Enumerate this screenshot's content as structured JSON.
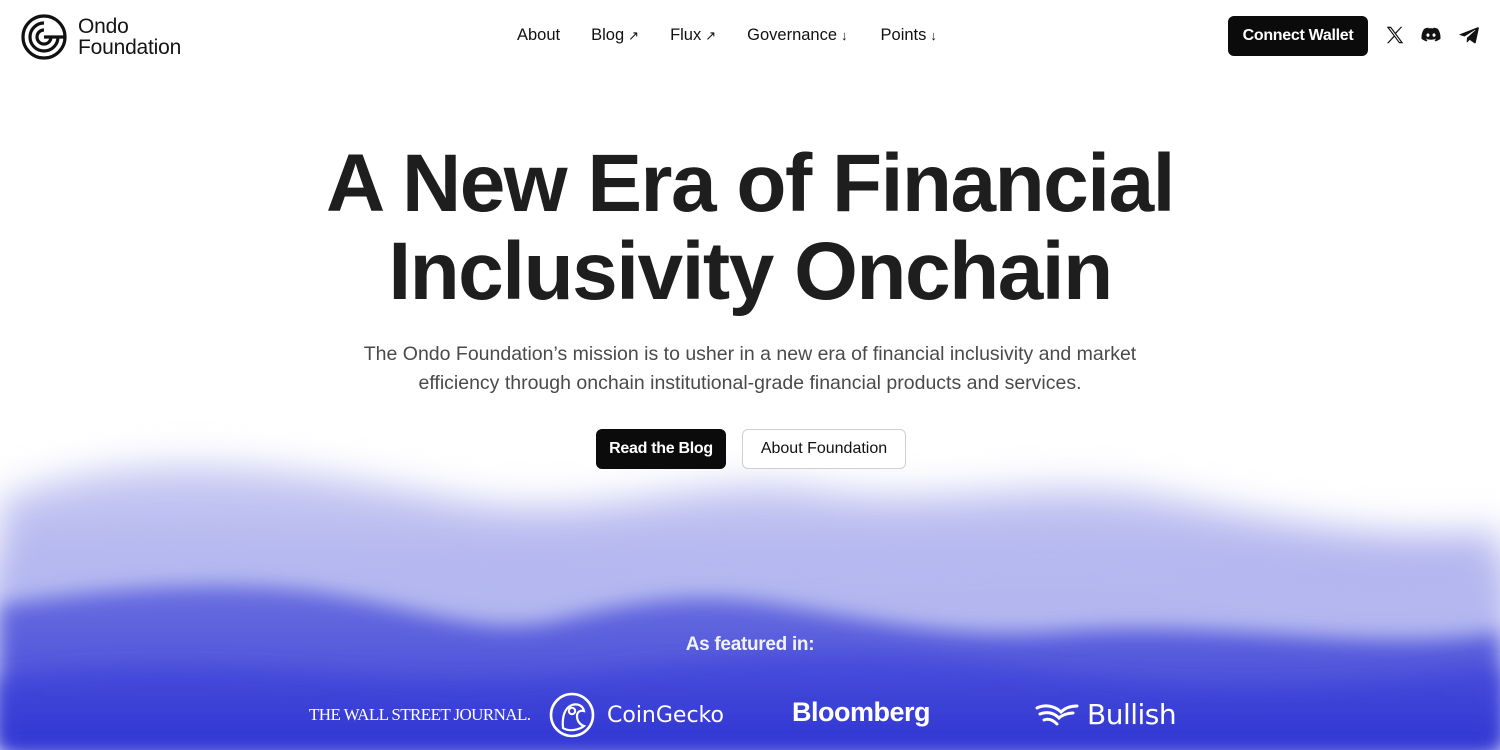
{
  "brand": {
    "line1": "Ondo",
    "line2": "Foundation"
  },
  "nav": {
    "items": [
      {
        "label": "About",
        "arrow": ""
      },
      {
        "label": "Blog",
        "arrow": "↗"
      },
      {
        "label": "Flux",
        "arrow": "↗"
      },
      {
        "label": "Governance",
        "arrow": "↓"
      },
      {
        "label": "Points",
        "arrow": "↓"
      }
    ],
    "connect_label": "Connect Wallet",
    "social_icons": [
      "x-icon",
      "discord-icon",
      "telegram-icon"
    ]
  },
  "hero": {
    "title_line1": "A New Era of Financial",
    "title_line2": "Inclusivity Onchain",
    "subtitle_line1": "The Ondo Foundation’s mission is to usher in a new era of financial inclusivity and market",
    "subtitle_line2": "efficiency through onchain institutional-grade financial products and services.",
    "primary_button": "Read the Blog",
    "secondary_button": "About Foundation"
  },
  "featured": {
    "heading": "As featured in:",
    "outlets": [
      "THE WALL STREET JOURNAL.",
      "CoinGecko",
      "Bloomberg",
      "Bullish"
    ]
  },
  "colors": {
    "accent_blue": "#3a3fd6",
    "dark": "#0b0b0b",
    "text": "#1e1e1e"
  }
}
